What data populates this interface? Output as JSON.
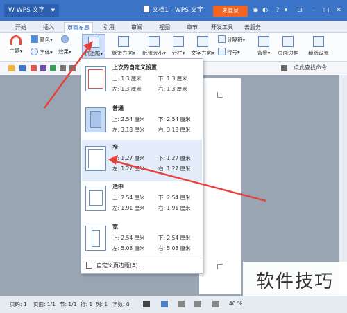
{
  "app": {
    "name": "WPS 文字",
    "document_title": "文档1 - WPS 文字",
    "login_label": "未登录",
    "brand_color": "#3b73c6",
    "login_color": "#f26522"
  },
  "tabs": [
    "开始",
    "插入",
    "页面布局",
    "引用",
    "审阅",
    "视图",
    "章节",
    "开发工具",
    "云服务"
  ],
  "active_tab": "页面布局",
  "ribbon": {
    "theme": "主题",
    "color": "颜色",
    "font": "字体",
    "effect": "效果",
    "margins": "页边距",
    "orientation": "纸张方向",
    "size": "纸张大小",
    "columns": "分栏",
    "text_direction": "文字方向",
    "separator": "分隔符",
    "line_number": "行号",
    "background": "背景",
    "page_border": "页面边框",
    "draft_setting": "稿纸设置"
  },
  "quick_access": {
    "find_label": "点此查找命令"
  },
  "margin_menu": {
    "options": [
      {
        "name": "上次的自定义设置",
        "top": "上: 1.3 厘米",
        "bottom": "下: 1.3 厘米",
        "left": "左: 1.3 厘米",
        "right": "右: 1.3 厘米"
      },
      {
        "name": "普通",
        "top": "上: 2.54 厘米",
        "bottom": "下: 2.54 厘米",
        "left": "左: 3.18 厘米",
        "right": "右: 3.18 厘米"
      },
      {
        "name": "窄",
        "top": "上: 1.27 厘米",
        "bottom": "下: 1.27 厘米",
        "left": "左: 1.27 厘米",
        "right": "右: 1.27 厘米"
      },
      {
        "name": "适中",
        "top": "上: 2.54 厘米",
        "bottom": "下: 2.54 厘米",
        "left": "左: 1.91 厘米",
        "right": "右: 1.91 厘米"
      },
      {
        "name": "宽",
        "top": "上: 2.54 厘米",
        "bottom": "下: 2.54 厘米",
        "left": "左: 5.08 厘米",
        "right": "右: 5.08 厘米"
      }
    ],
    "custom_label": "自定义页边距(A)..."
  },
  "statusbar": {
    "page": "页码: 1",
    "pages": "页面: 1/1",
    "section": "节: 1/1",
    "row": "行: 1",
    "col": "列: 1",
    "words": "字数: 0",
    "zoom": "40 %"
  },
  "watermark": "软件技巧",
  "annotation_color": "#e8403a"
}
